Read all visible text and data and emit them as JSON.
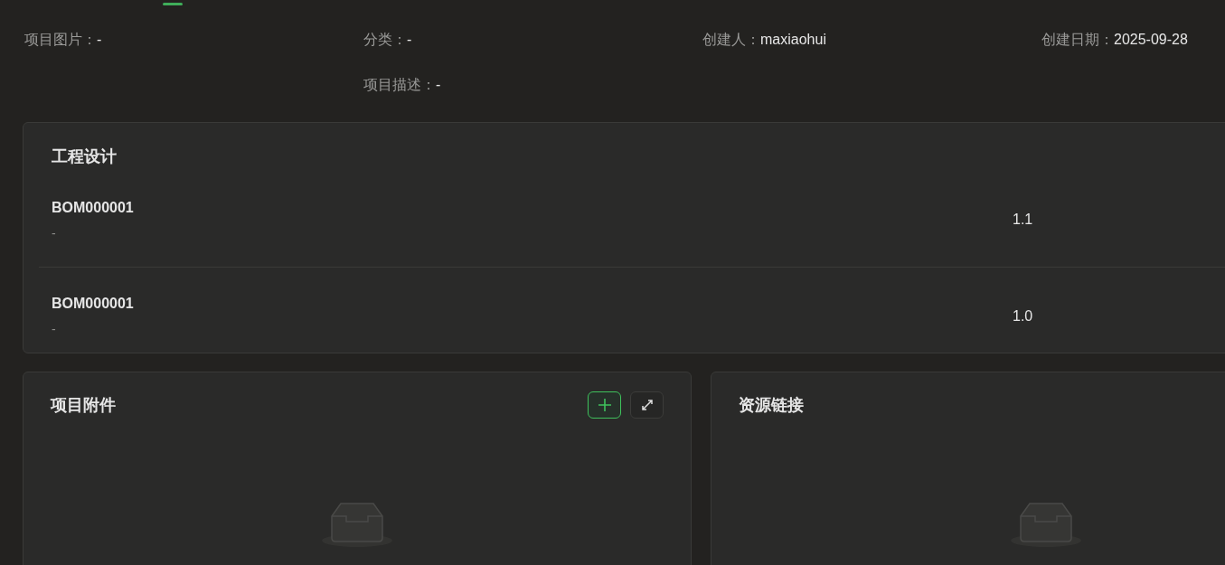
{
  "info_fields": [
    {
      "label": "项目图片：",
      "value": "-"
    },
    {
      "label": "分类：",
      "value": "-"
    },
    {
      "label": "创建人：",
      "value": "maxiaohui"
    },
    {
      "label": "创建日期：",
      "value": "2025-09-28"
    }
  ],
  "description": {
    "label": "项目描述：",
    "value": "-"
  },
  "engineering": {
    "title": "工程设计",
    "rows": [
      {
        "code": "BOM000001",
        "note": "-",
        "version": "1.1"
      },
      {
        "code": "BOM000001",
        "note": "-",
        "version": "1.0"
      }
    ]
  },
  "attachments": {
    "title": "项目附件"
  },
  "resources": {
    "title": "资源链接"
  }
}
